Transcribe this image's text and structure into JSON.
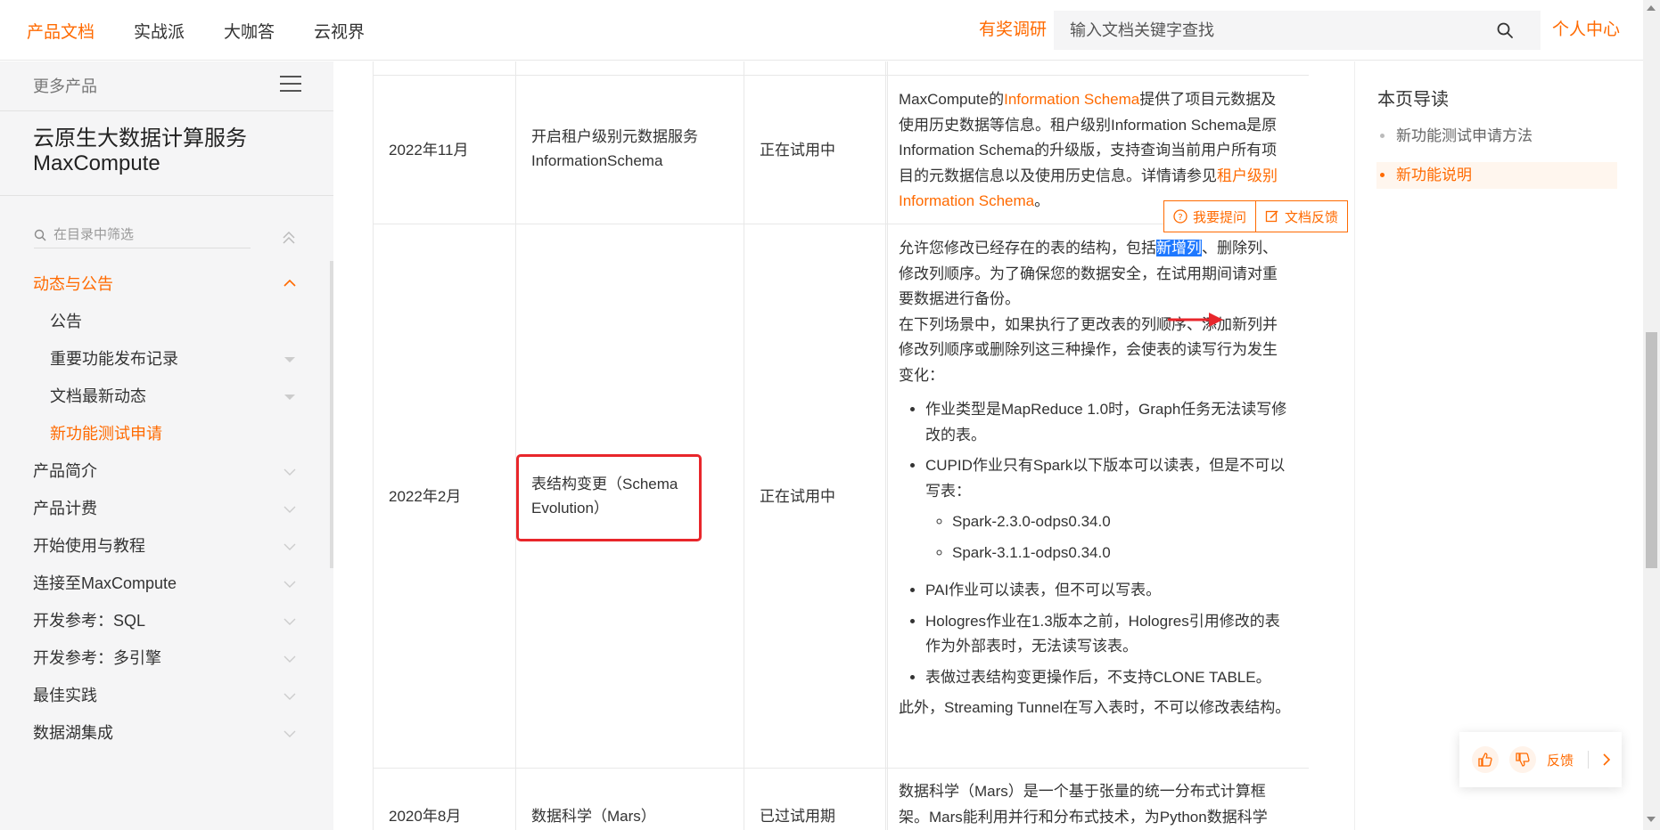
{
  "topnav": {
    "items": [
      "产品文档",
      "实战派",
      "大咖答",
      "云视界"
    ],
    "reward": "有奖调研",
    "search_placeholder": "输入文档关键字查找",
    "personal": "个人中心"
  },
  "sidebar": {
    "more": "更多产品",
    "product_title_line1": "云原生大数据计算服务",
    "product_title_line2": "MaxCompute",
    "filter_placeholder": "在目录中筛选",
    "items": [
      {
        "label": "动态与公告"
      },
      {
        "label": "公告"
      },
      {
        "label": "重要功能发布记录"
      },
      {
        "label": "文档最新动态"
      },
      {
        "label": "新功能测试申请"
      },
      {
        "label": "产品简介"
      },
      {
        "label": "产品计费"
      },
      {
        "label": "开始使用与教程"
      },
      {
        "label": "连接至MaxCompute"
      },
      {
        "label": "开发参考：SQL"
      },
      {
        "label": "开发参考：多引擎"
      },
      {
        "label": "最佳实践"
      },
      {
        "label": "数据湖集成"
      }
    ]
  },
  "table": {
    "rows": [
      {
        "date": "2022年11月",
        "feature_line1": "开启租户级别元数据服务",
        "feature_line2": "InformationSchema",
        "status": "正在试用中",
        "desc_a": "MaxCompute的",
        "desc_link1": "Information Schema",
        "desc_b": "提供了项目元数据及使用历史数据等信息。租户级别Information Schema是原Information Schema的升级版，支持查询当前用户所有项目的元数据信息以及使用历史信息。详情请参见",
        "desc_link2": "租户级别Information Schema",
        "desc_c": "。"
      },
      {
        "date": "2022年2月",
        "feature_line1": "表结构变更（Schema",
        "feature_line2": "Evolution）",
        "status": "正在试用中",
        "p1_a": "允许您修改已经存在的表的结构，包括",
        "p1_hl": "新增列",
        "p1_b": "、删除列、修改列顺序。为了确保您的数据安全，在试用期间请对重要数据进行备份。",
        "p2": "在下列场景中，如果执行了更改表的列顺序、添加新列并修改列顺序或删除列这三种操作，会使表的读写行为发生变化：",
        "li1": "作业类型是MapReduce 1.0时，Graph任务无法读写修改的表。",
        "li2": "CUPID作业只有Spark以下版本可以读表，但是不可以写表：",
        "li2_sub1": "Spark-2.3.0-odps0.34.0",
        "li2_sub2": "Spark-3.1.1-odps0.34.0",
        "li3": "PAI作业可以读表，但不可以写表。",
        "li4": "Hologres作业在1.3版本之前，Hologres引用修改的表作为外部表时，无法读写该表。",
        "li5": "表做过表结构变更操作后，不支持CLONE TABLE。",
        "p3": "此外，Streaming Tunnel在写入表时，不可以修改表结构。"
      },
      {
        "date": "2020年8月",
        "feature_line1": "数据科学（Mars）",
        "status": "已过试用期",
        "desc": "数据科学（Mars）是一个基于张量的统一分布式计算框架。Mars能利用并行和分布式技术，为Python数据科学"
      }
    ]
  },
  "mini_feedback": {
    "ask": "我要提问",
    "doc_feedback": "文档反馈"
  },
  "toc": {
    "title": "本页导读",
    "items": [
      "新功能测试申请方法",
      "新功能说明"
    ]
  },
  "float_feedback": {
    "label": "反馈"
  },
  "colors": {
    "accent": "#ff6a00",
    "highlight": "#1e78ff",
    "annotation": "#e8262b"
  }
}
